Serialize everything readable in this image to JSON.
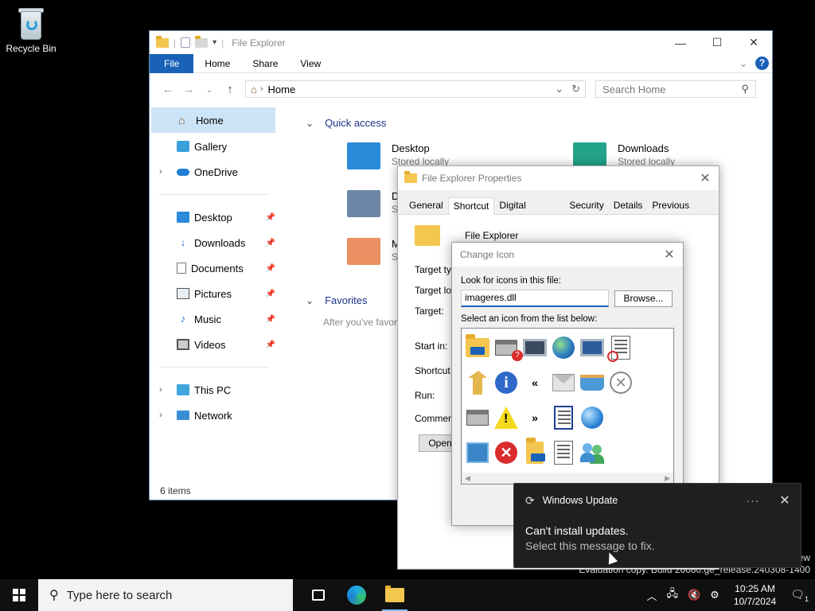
{
  "desktop": {
    "recycle_bin_label": "Recycle Bin"
  },
  "explorer": {
    "title": "File Explorer",
    "ribbon_tabs": [
      "File",
      "Home",
      "Share",
      "View"
    ],
    "address": "Home",
    "search_placeholder": "Search Home",
    "sidebar": [
      {
        "label": "Home",
        "icon": "home-icon",
        "selected": true
      },
      {
        "label": "Gallery",
        "icon": "gallery-icon"
      },
      {
        "label": "OneDrive",
        "icon": "cloud-icon",
        "expandable": true
      },
      {
        "label": "Desktop",
        "icon": "desktop-icon",
        "pinned": true
      },
      {
        "label": "Downloads",
        "icon": "download-icon",
        "pinned": true
      },
      {
        "label": "Documents",
        "icon": "documents-icon",
        "pinned": true
      },
      {
        "label": "Pictures",
        "icon": "pictures-icon",
        "pinned": true
      },
      {
        "label": "Music",
        "icon": "music-icon",
        "pinned": true
      },
      {
        "label": "Videos",
        "icon": "videos-icon",
        "pinned": true
      },
      {
        "label": "This PC",
        "icon": "pc-icon",
        "expandable": true
      },
      {
        "label": "Network",
        "icon": "network-icon",
        "expandable": true
      }
    ],
    "quick_access_label": "Quick access",
    "favorites_label": "Favorites",
    "favorites_hint": "After you've favor",
    "tiles": [
      {
        "name": "Desktop",
        "sub": "Stored locally"
      },
      {
        "name": "Downloads",
        "sub": "Stored locally"
      },
      {
        "name": "D",
        "sub": "S"
      },
      {
        "name": "M",
        "sub": "S"
      }
    ],
    "status": "6 items"
  },
  "properties": {
    "title": "File Explorer Properties",
    "tabs": [
      "General",
      "Shortcut",
      "Digital Signatures",
      "Security",
      "Details",
      "Previous Versions"
    ],
    "active_tab": "Shortcut",
    "name": "File Explorer",
    "labels": {
      "target_type": "Target typ",
      "target_location": "Target loc",
      "target": "Target:",
      "start_in": "Start in:",
      "shortcut_key": "Shortcut k",
      "run": "Run:",
      "comment": "Comment:"
    },
    "open_button": "Open"
  },
  "change_icon": {
    "title": "Change Icon",
    "look_for_label": "Look for icons in this file:",
    "file_value": "imageres.dll",
    "browse_button": "Browse...",
    "select_label": "Select an icon from the list below:",
    "icons": [
      "folder-icon",
      "printer-help-icon",
      "computer-icon",
      "globe-icon",
      "monitor-icon",
      "blocked-doc-icon",
      "folder-up-icon",
      "info-icon",
      "rewind-icon",
      "mail-icon",
      "basket-icon",
      "x-circle-icon",
      "printer-icon",
      "warning-icon",
      "forward-icon",
      "window-icon",
      "globe-arrow-icon",
      "",
      "app-icon",
      "error-icon",
      "folder-open-icon",
      "document-icon",
      "users-icon",
      ""
    ]
  },
  "toast": {
    "app": "Windows Update",
    "line1": "Can't install updates.",
    "line2": "Select this message to fix."
  },
  "watermark": {
    "line1": "ew",
    "line2": "Evaluation copy. Build 26080.ge_release.240308-1400"
  },
  "taskbar": {
    "search_placeholder": "Type here to search",
    "time": "10:25 AM",
    "date": "10/7/2024",
    "notification_count": "1"
  }
}
